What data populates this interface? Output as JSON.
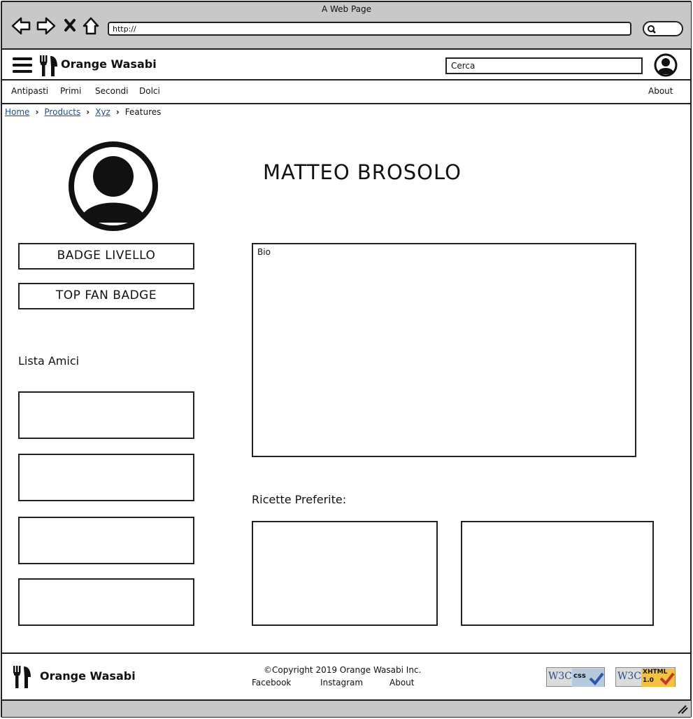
{
  "browser": {
    "title": "A Web Page",
    "url": "http://"
  },
  "header": {
    "brand": "Orange Wasabi",
    "search_placeholder": "Cerca"
  },
  "nav": {
    "items": [
      "Antipasti",
      "Primi",
      "Secondi",
      "Dolci"
    ],
    "about": "About"
  },
  "breadcrumb": {
    "items": [
      "Home",
      "Products",
      "Xyz"
    ],
    "current": "Features"
  },
  "profile": {
    "name": "MATTEO BROSOLO",
    "badges": [
      "BADGE LIVELLO",
      "TOP FAN BADGE"
    ],
    "friends_label": "Lista Amici",
    "bio_label": "Bio",
    "favorites_label": "Ricette Preferite:"
  },
  "footer": {
    "brand": "Orange Wasabi",
    "copyright": "©Copyright 2019 Orange Wasabi Inc.",
    "links": [
      "Facebook",
      "Instagram",
      "About"
    ],
    "w3c_css": "css",
    "w3c_xhtml": "XHTML",
    "w3c_xhtml_version": "1.0"
  }
}
